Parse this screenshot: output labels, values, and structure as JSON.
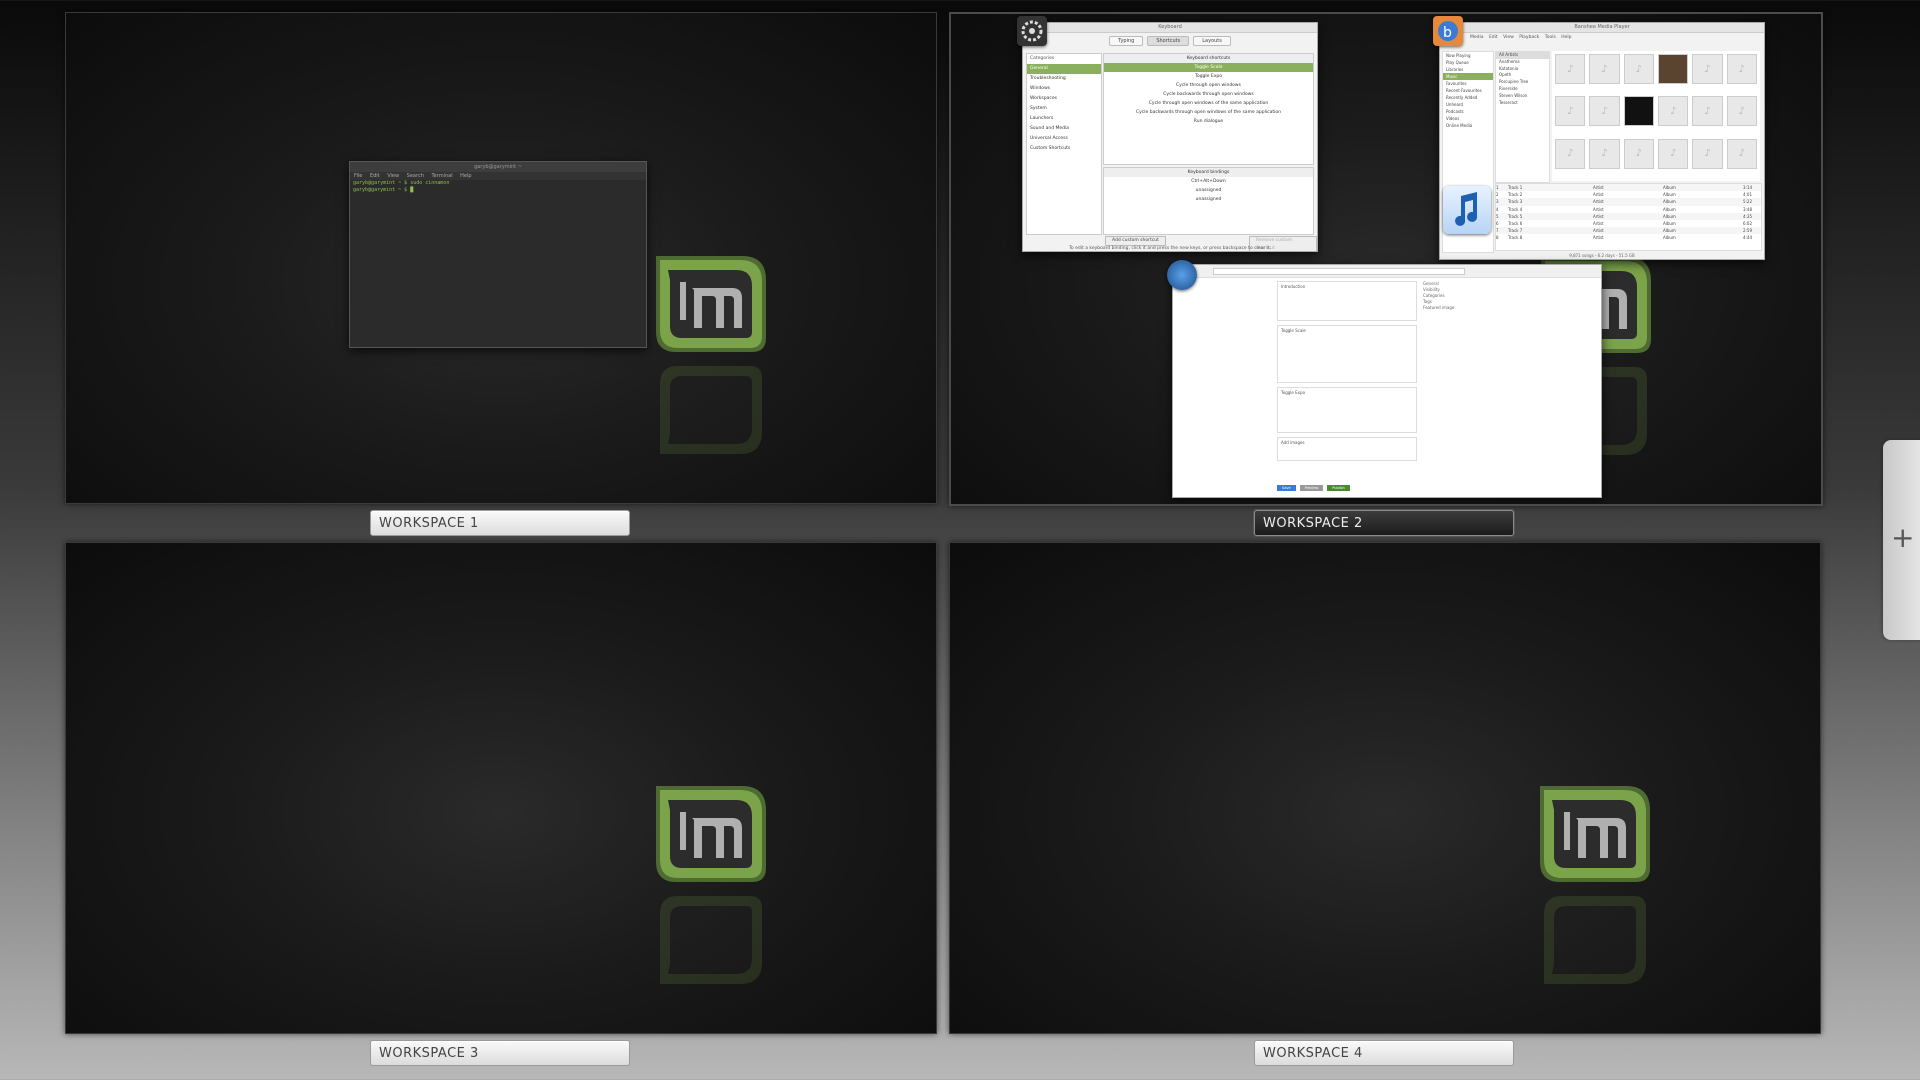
{
  "workspaces": [
    {
      "label": "WORKSPACE 1",
      "active": false
    },
    {
      "label": "WORKSPACE 2",
      "active": true
    },
    {
      "label": "WORKSPACE 3",
      "active": false
    },
    {
      "label": "WORKSPACE 4",
      "active": false
    }
  ],
  "add_workspace": {
    "label": "+"
  },
  "terminal": {
    "title": "garyb@garymint ~",
    "menu": "File  Edit  View  Search  Terminal  Help",
    "line1": "garyb@garymint ~ $ sudo cinnamon",
    "line2": "garyb@garymint ~ $ █"
  },
  "keyboard_window": {
    "title": "Keyboard",
    "tabs": [
      "Typing",
      "Shortcuts",
      "Layouts"
    ],
    "categories_header": "Categories",
    "categories": [
      "General",
      "Troubleshooting",
      "Windows",
      "Workspaces",
      "System",
      "Launchers",
      "Sound and Media",
      "Universal Access",
      "Custom Shortcuts"
    ],
    "shortcuts_header": "Keyboard shortcuts",
    "shortcuts": [
      "Toggle Scale",
      "Toggle Expo",
      "Cycle through open windows",
      "Cycle backwards through open windows",
      "Cycle through open windows of the same application",
      "Cycle backwards through open windows of the same application",
      "Run dialogue"
    ],
    "bindings_header": "Keyboard bindings",
    "bindings": [
      "Ctrl+Alt+Down",
      "unassigned",
      "unassigned"
    ],
    "add_custom": "Add custom shortcut",
    "remove_custom": "Remove custom shortcut",
    "footer": "To edit a keyboard binding, click it and press the new keys, or press backspace to clear it."
  },
  "music_window": {
    "title": "Banshee Media Player",
    "menu": "Media  Edit  View  Playback  Tools  Help",
    "side": [
      "Now Playing",
      "Play Queue",
      "Libraries",
      "Music",
      "Favourites",
      "Recent Favourites",
      "Recently Added",
      "Unheard",
      "Podcasts",
      "Videos",
      "Online Media"
    ],
    "artists": [
      "All Artists",
      "Anathema",
      "Katatonia",
      "Opeth",
      "Porcupine Tree",
      "Riverside",
      "Steven Wilson",
      "Tesseract"
    ],
    "tracks": [
      {
        "n": "1",
        "name": "Track 1",
        "artist": "Artist",
        "album": "Album",
        "time": "3:14"
      },
      {
        "n": "2",
        "name": "Track 2",
        "artist": "Artist",
        "album": "Album",
        "time": "4:01"
      },
      {
        "n": "3",
        "name": "Track 3",
        "artist": "Artist",
        "album": "Album",
        "time": "5:22"
      },
      {
        "n": "4",
        "name": "Track 4",
        "artist": "Artist",
        "album": "Album",
        "time": "3:48"
      },
      {
        "n": "5",
        "name": "Track 5",
        "artist": "Artist",
        "album": "Album",
        "time": "4:35"
      },
      {
        "n": "6",
        "name": "Track 6",
        "artist": "Artist",
        "album": "Album",
        "time": "6:02"
      },
      {
        "n": "7",
        "name": "Track 7",
        "artist": "Artist",
        "album": "Album",
        "time": "2:59"
      },
      {
        "n": "8",
        "name": "Track 8",
        "artist": "Artist",
        "album": "Album",
        "time": "4:44"
      }
    ],
    "status": "9,871 songs - 6.2 days - 51.5 GB"
  },
  "browser_window": {
    "title": "Web Browser",
    "cards": [
      "Introduction",
      "Toggle Scale",
      "Toggle Expo",
      "Add images"
    ],
    "side": [
      "General",
      "Visibility",
      "Categories",
      "Tags",
      "Featured image"
    ],
    "buttons": [
      "Save",
      "Preview",
      "Publish"
    ]
  },
  "colors": {
    "mint_green": "#8bb05d",
    "dark_panel": "#1c1c1c",
    "label_light": "#dcdcdc"
  }
}
